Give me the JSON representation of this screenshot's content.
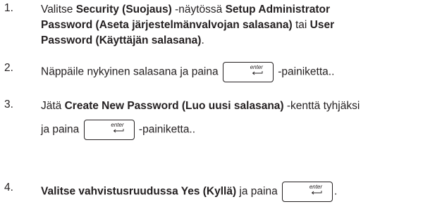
{
  "steps": [
    {
      "num": "1.",
      "line1": {
        "t1": "Valitse ",
        "b1": "Security (Suojaus)",
        "t2": " -näytössä ",
        "b2": "Setup Administrator"
      },
      "line2": {
        "b1": "Password (Aseta järjestelmänvalvojan salasana)",
        "t1": " tai ",
        "b2": "User"
      },
      "line3": {
        "b1": "Password (Käyttäjän salasana)",
        "t1": "."
      }
    },
    {
      "num": "2.",
      "line1": {
        "t1": "Näppäile nykyinen salasana ja paina",
        "t2": "-painiketta.."
      }
    },
    {
      "num": "3.",
      "line1": {
        "t1": "Jätä ",
        "b1": "Create New Password (Luo uusi salasana)",
        "t2": " -kenttä tyhjäksi"
      },
      "line2": {
        "t1": "ja paina",
        "t2": "-painiketta.."
      }
    },
    {
      "num": "4.",
      "line1": {
        "b1": "Valitse vahvistusruudussa Yes (Kyllä)",
        "t1": " ja paina",
        "t2": "."
      }
    }
  ],
  "key_label": "enter",
  "icons": {
    "enter_key": "enter-key-icon",
    "return_arrow": "return-arrow-icon"
  }
}
